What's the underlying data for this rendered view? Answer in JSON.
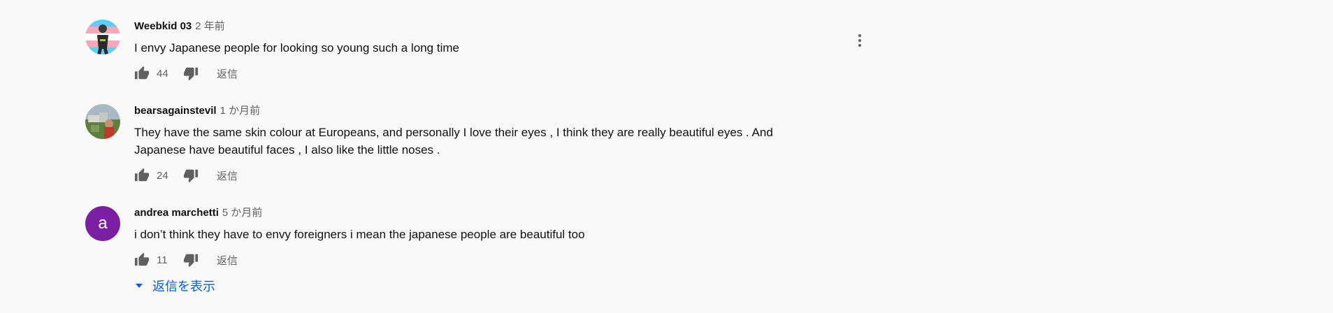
{
  "comments": [
    {
      "author": "Weebkid 03",
      "time": "2 年前",
      "text": "I envy Japanese people for looking so young such a long time",
      "likes": "44",
      "reply_label": "返信"
    },
    {
      "author": "bearsagainstevil",
      "time": "1 か月前",
      "text_lines": [
        "They have the same skin colour at Europeans, and personally I love their eyes , I think they are really beautiful eyes . And",
        "Japanese have beautiful faces , I also like the little noses ."
      ],
      "likes": "24",
      "reply_label": "返信"
    },
    {
      "author": "andrea marchetti",
      "time": "5 か月前",
      "avatar_letter": "a",
      "avatar_color": "#7b1fa2",
      "text": "i don’t think they have to envy foreigners i mean the japanese people are beautiful too",
      "likes": "11",
      "reply_label": "返信"
    }
  ],
  "show_replies_label": "返信を表示",
  "icons": {
    "like": "thumb-up-icon",
    "dislike": "thumb-down-icon",
    "more": "more-vert-icon",
    "expand": "caret-down-icon"
  },
  "colors": {
    "link_blue": "#065fd4",
    "secondary_text": "#606060"
  }
}
